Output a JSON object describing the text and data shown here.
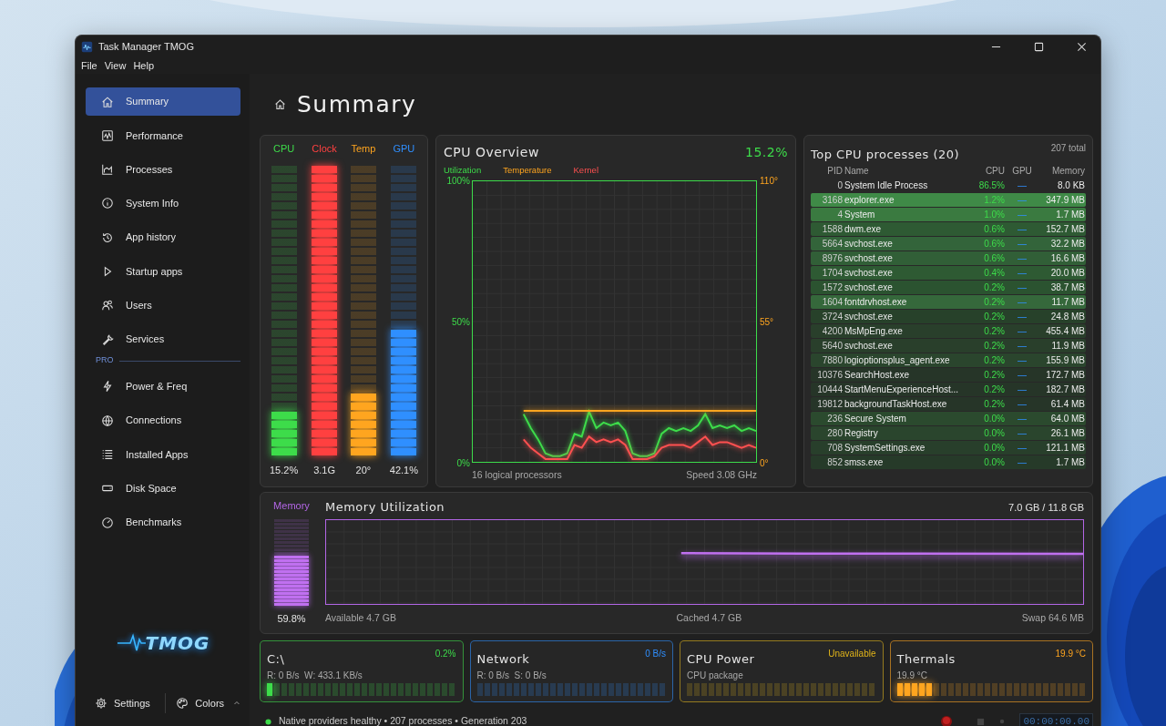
{
  "window": {
    "title": "Task Manager TMOG"
  },
  "menu": [
    "File",
    "View",
    "Help"
  ],
  "sidebar": {
    "groups": [
      {
        "items": [
          {
            "label": "Summary",
            "selected": true
          },
          {
            "label": "Performance",
            "selected": false
          },
          {
            "label": "Processes",
            "selected": false
          },
          {
            "label": "System Info",
            "selected": false
          },
          {
            "label": "App history",
            "selected": false
          },
          {
            "label": "Startup apps",
            "selected": false
          },
          {
            "label": "Users",
            "selected": false
          },
          {
            "label": "Services",
            "selected": false
          }
        ]
      },
      {
        "heading": "PRO",
        "items": [
          {
            "label": "Power & Freq",
            "selected": false
          },
          {
            "label": "Connections",
            "selected": false
          },
          {
            "label": "Installed Apps",
            "selected": false
          },
          {
            "label": "Disk Space",
            "selected": false
          },
          {
            "label": "Benchmarks",
            "selected": false
          }
        ]
      }
    ],
    "logo": "TMOG",
    "settings": "Settings",
    "colors": "Colors"
  },
  "page_title": "Summary",
  "meters": [
    {
      "label": "CPU",
      "reading": "15.2%",
      "level": 0.152,
      "color": "#3ddc4a"
    },
    {
      "label": "Clock",
      "reading": "3.1G",
      "level": 1,
      "color": "#ff4040"
    },
    {
      "label": "Temp",
      "reading": "20°",
      "level": 0.22,
      "color": "#ffa51f"
    },
    {
      "label": "GPU",
      "reading": "42.1%",
      "level": 0.44,
      "color": "#2f8fff"
    }
  ],
  "cpu_overview": {
    "title": "CPU Overview",
    "value": "15.2%",
    "footer_left": "16 logical processors",
    "footer_right": "Speed 3.08 GHz",
    "chart_data": {
      "type": "line",
      "grid": true,
      "ylim": [
        0,
        100
      ],
      "yticks": [
        {
          "value": 0,
          "label": "0%"
        },
        {
          "value": 50,
          "label": "50%"
        },
        {
          "value": 100,
          "label": "100%"
        }
      ],
      "y2lim": [
        0,
        110
      ],
      "y2ticks": [
        {
          "value": 0,
          "label": "0°"
        },
        {
          "value": 55,
          "label": "55°"
        },
        {
          "value": 110,
          "label": "110°"
        }
      ],
      "series": [
        {
          "name": "Utilization",
          "color": "#3ddc4a",
          "values": [
            null,
            null,
            null,
            null,
            null,
            null,
            null,
            17,
            12,
            8,
            3,
            2,
            2,
            3,
            10,
            9,
            18,
            12,
            14,
            13,
            14,
            11,
            3,
            2,
            2,
            3,
            10,
            12,
            11,
            12,
            11,
            13,
            17,
            12,
            13,
            12,
            13,
            11,
            12,
            11
          ]
        },
        {
          "name": "Temperature",
          "color": "#ffa51f",
          "axis": "y2",
          "values": [
            null,
            null,
            null,
            null,
            null,
            null,
            null,
            20,
            20,
            20,
            20,
            20,
            20,
            20,
            20,
            20,
            20,
            20,
            20,
            20,
            20,
            20,
            20,
            20,
            20,
            20,
            20,
            20,
            20,
            20,
            20,
            20,
            20,
            20,
            20,
            20,
            20,
            20,
            20,
            20
          ]
        },
        {
          "name": "Kernel",
          "color": "#ff5050",
          "values": [
            null,
            null,
            null,
            null,
            null,
            null,
            null,
            8,
            5,
            3,
            1,
            1,
            1,
            1,
            6,
            5,
            9,
            7,
            8,
            7,
            8,
            6,
            1,
            1,
            1,
            2,
            5,
            6,
            6,
            6,
            5,
            7,
            9,
            6,
            7,
            7,
            6,
            5,
            6,
            5
          ]
        }
      ]
    }
  },
  "processes": {
    "title": "Top CPU processes (20)",
    "total": "207 total",
    "columns": [
      "PID",
      "Name",
      "CPU",
      "GPU",
      "Memory"
    ],
    "rows": [
      {
        "pid": "0",
        "name": "System Idle Process",
        "cpu": "86.5%",
        "gpu": "—",
        "memory": "8.0 KB"
      },
      {
        "pid": "3168",
        "name": "explorer.exe",
        "cpu": "1.2%",
        "gpu": "—",
        "memory": "347.9 MB",
        "color": "#3f8a47"
      },
      {
        "pid": "4",
        "name": "System",
        "cpu": "1.0%",
        "gpu": "—",
        "memory": "1.7 MB",
        "color": "#3a7a40"
      },
      {
        "pid": "1588",
        "name": "dwm.exe",
        "cpu": "0.6%",
        "gpu": "—",
        "memory": "152.7 MB",
        "color": "#2e5a33"
      },
      {
        "pid": "5664",
        "name": "svchost.exe",
        "cpu": "0.6%",
        "gpu": "—",
        "memory": "32.2 MB",
        "color": "#33643a"
      },
      {
        "pid": "8976",
        "name": "svchost.exe",
        "cpu": "0.6%",
        "gpu": "—",
        "memory": "16.6 MB",
        "color": "#315f37"
      },
      {
        "pid": "1704",
        "name": "svchost.exe",
        "cpu": "0.4%",
        "gpu": "—",
        "memory": "20.0 MB",
        "color": "#2e5a33"
      },
      {
        "pid": "1572",
        "name": "svchost.exe",
        "cpu": "0.2%",
        "gpu": "—",
        "memory": "38.7 MB",
        "color": "#2b5330"
      },
      {
        "pid": "1604",
        "name": "fontdrvhost.exe",
        "cpu": "0.2%",
        "gpu": "—",
        "memory": "11.7 MB",
        "color": "#35683b"
      },
      {
        "pid": "3724",
        "name": "svchost.exe",
        "cpu": "0.2%",
        "gpu": "—",
        "memory": "24.8 MB",
        "color": "#27412a"
      },
      {
        "pid": "4200",
        "name": "MsMpEng.exe",
        "cpu": "0.2%",
        "gpu": "—",
        "memory": "455.4 MB",
        "color": "#293f2b"
      },
      {
        "pid": "5640",
        "name": "svchost.exe",
        "cpu": "0.2%",
        "gpu": "—",
        "memory": "11.9 MB",
        "color": "#293f2b"
      },
      {
        "pid": "7880",
        "name": "logioptionsplus_agent.exe",
        "cpu": "0.2%",
        "gpu": "—",
        "memory": "155.9 MB",
        "color": "#2a452d"
      },
      {
        "pid": "10376",
        "name": "SearchHost.exe",
        "cpu": "0.2%",
        "gpu": "—",
        "memory": "172.7 MB",
        "color": "#263528"
      },
      {
        "pid": "10444",
        "name": "StartMenuExperienceHost...",
        "cpu": "0.2%",
        "gpu": "—",
        "memory": "182.7 MB",
        "color": "#263528"
      },
      {
        "pid": "19812",
        "name": "backgroundTaskHost.exe",
        "cpu": "0.2%",
        "gpu": "—",
        "memory": "61.4 MB",
        "color": "#263528"
      },
      {
        "pid": "236",
        "name": "Secure System",
        "cpu": "0.0%",
        "gpu": "—",
        "memory": "64.0 MB",
        "color": "#2b4a2e"
      },
      {
        "pid": "280",
        "name": "Registry",
        "cpu": "0.0%",
        "gpu": "—",
        "memory": "26.1 MB",
        "color": "#2a452d"
      },
      {
        "pid": "708",
        "name": "SystemSettings.exe",
        "cpu": "0.0%",
        "gpu": "—",
        "memory": "121.1 MB",
        "color": "#283f2b"
      },
      {
        "pid": "852",
        "name": "smss.exe",
        "cpu": "0.0%",
        "gpu": "—",
        "memory": "1.7 MB",
        "color": "#263a29"
      }
    ]
  },
  "memory": {
    "label": "Memory",
    "reading": "59.8%",
    "level": 0.598,
    "title": "Memory Utilization",
    "total": "7.0 GB / 11.8 GB",
    "available": "Available 4.7 GB",
    "cached": "Cached 4.7 GB",
    "swap": "Swap 64.6 MB"
  },
  "cards": [
    {
      "title": "C:\\",
      "value": "0.2%",
      "detail": "R: 0 B/s  W: 433.1 KB/s",
      "level": 0.04,
      "color": "#3ddc4a"
    },
    {
      "title": "Network",
      "value": "0 B/s",
      "detail": "R: 0 B/s  S: 0 B/s",
      "level": 0,
      "color": "#2f8fff"
    },
    {
      "title": "CPU Power",
      "value": "Unavailable",
      "detail": "CPU package",
      "level": 0,
      "color": "#e0b41a"
    },
    {
      "title": "Thermals",
      "value": "19.9 °C",
      "detail": "19.9 °C",
      "level": 0.2,
      "color": "#ffa51f"
    }
  ],
  "status": {
    "text": "Native providers healthy • 207 processes • Generation 203",
    "timer": "00:00:00.00"
  }
}
